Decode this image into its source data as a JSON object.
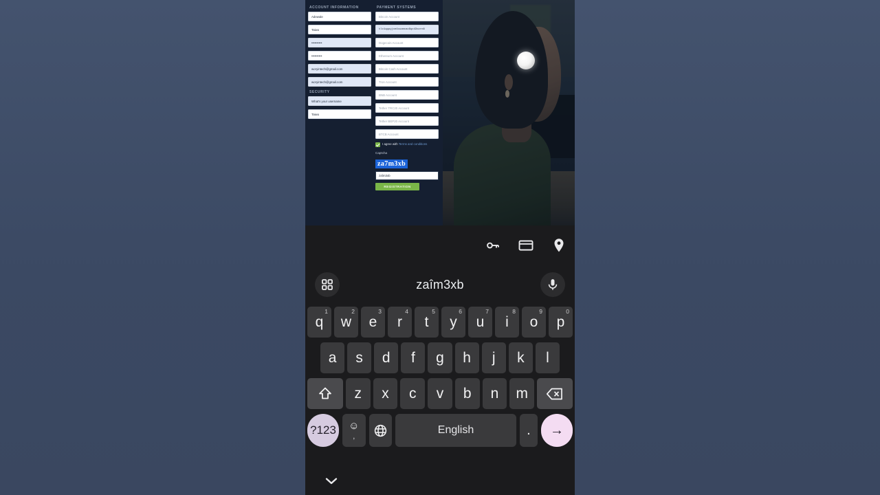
{
  "backdrop": {
    "color": "#3c4a63"
  },
  "webpage": {
    "account_section": {
      "title": "ACCOUNT INFORMATION",
      "fields": [
        {
          "name": "first-name",
          "value": "Adewale",
          "state": "filled"
        },
        {
          "name": "last-name",
          "value": "Taiwo",
          "state": "filled"
        },
        {
          "name": "password",
          "value": "••••••••••",
          "state": "autofill"
        },
        {
          "name": "confirm-password",
          "value": "••••••••••",
          "state": "filled"
        },
        {
          "name": "email",
          "value": "woryintech@gmail.com",
          "state": "autofill"
        },
        {
          "name": "confirm-email",
          "value": "woryintech@gmail.com",
          "state": "autofill"
        }
      ]
    },
    "security_section": {
      "title": "SECURITY",
      "fields": [
        {
          "name": "security-question",
          "value": "What's your username",
          "state": "autofill"
        },
        {
          "name": "security-answer",
          "value": "Taiwo",
          "state": "filled"
        }
      ]
    },
    "payment_section": {
      "title": "PAYMENT SYSTEMS",
      "fields": [
        {
          "name": "bitcoin-account",
          "value": "Bitcoin Account",
          "state": "placeholder"
        },
        {
          "name": "bitcoin-address",
          "value": "tlc1qquyjce4cuzmcav9qx43scrn8",
          "state": "autofill"
        },
        {
          "name": "dogecoin-account",
          "value": "Dogecoin Account",
          "state": "placeholder"
        },
        {
          "name": "ethereum-account",
          "value": "Ethereum Account",
          "state": "placeholder"
        },
        {
          "name": "bitcoin-cash-account",
          "value": "Bitcoin Cash Account",
          "state": "placeholder"
        },
        {
          "name": "tron-account",
          "value": "Tron Account",
          "state": "placeholder"
        },
        {
          "name": "bnb-account",
          "value": "BNB Account",
          "state": "placeholder"
        },
        {
          "name": "tether-trc20-account",
          "value": "Tether TRC20 Account",
          "state": "placeholder"
        },
        {
          "name": "tether-bep20-account",
          "value": "Tether BEP20 Account",
          "state": "placeholder"
        },
        {
          "name": "btcb-account",
          "value": "BTCB Account",
          "state": "placeholder"
        }
      ]
    },
    "terms": {
      "text": "I agree with ",
      "link": "Terms and conditions",
      "checked": true,
      "checkbox_color": "#7ab648"
    },
    "captcha": {
      "label": "Captcha",
      "image_text": "za7m3xb",
      "image_bg": "#1b63d8",
      "input_value": "zaîm3xb"
    },
    "submit": {
      "label": "REGISTRATION",
      "color": "#7ab648"
    }
  },
  "keyboard": {
    "chips": [
      {
        "name": "password-key-icon"
      },
      {
        "name": "payment-card-icon"
      },
      {
        "name": "location-pin-icon"
      }
    ],
    "suggestion": "zaîm3xb",
    "left_button": "grid-icon",
    "right_button": "mic-icon",
    "rows": {
      "row1": [
        {
          "key": "q",
          "num": "1"
        },
        {
          "key": "w",
          "num": "2"
        },
        {
          "key": "e",
          "num": "3"
        },
        {
          "key": "r",
          "num": "4"
        },
        {
          "key": "t",
          "num": "5"
        },
        {
          "key": "y",
          "num": "6"
        },
        {
          "key": "u",
          "num": "7"
        },
        {
          "key": "i",
          "num": "8"
        },
        {
          "key": "o",
          "num": "9"
        },
        {
          "key": "p",
          "num": "0"
        }
      ],
      "row2": [
        "a",
        "s",
        "d",
        "f",
        "g",
        "h",
        "j",
        "k",
        "l"
      ],
      "row3": [
        "z",
        "x",
        "c",
        "v",
        "b",
        "n",
        "m"
      ],
      "row4": {
        "symbols": "?123",
        "emoji": "☺",
        "emoji_sub": ",",
        "language": "globe-icon",
        "space": "English",
        "period": ".",
        "enter": "→"
      }
    },
    "shift_key": "shift-icon",
    "backspace_key": "backspace-icon",
    "hide_keyboard": "⌄"
  }
}
